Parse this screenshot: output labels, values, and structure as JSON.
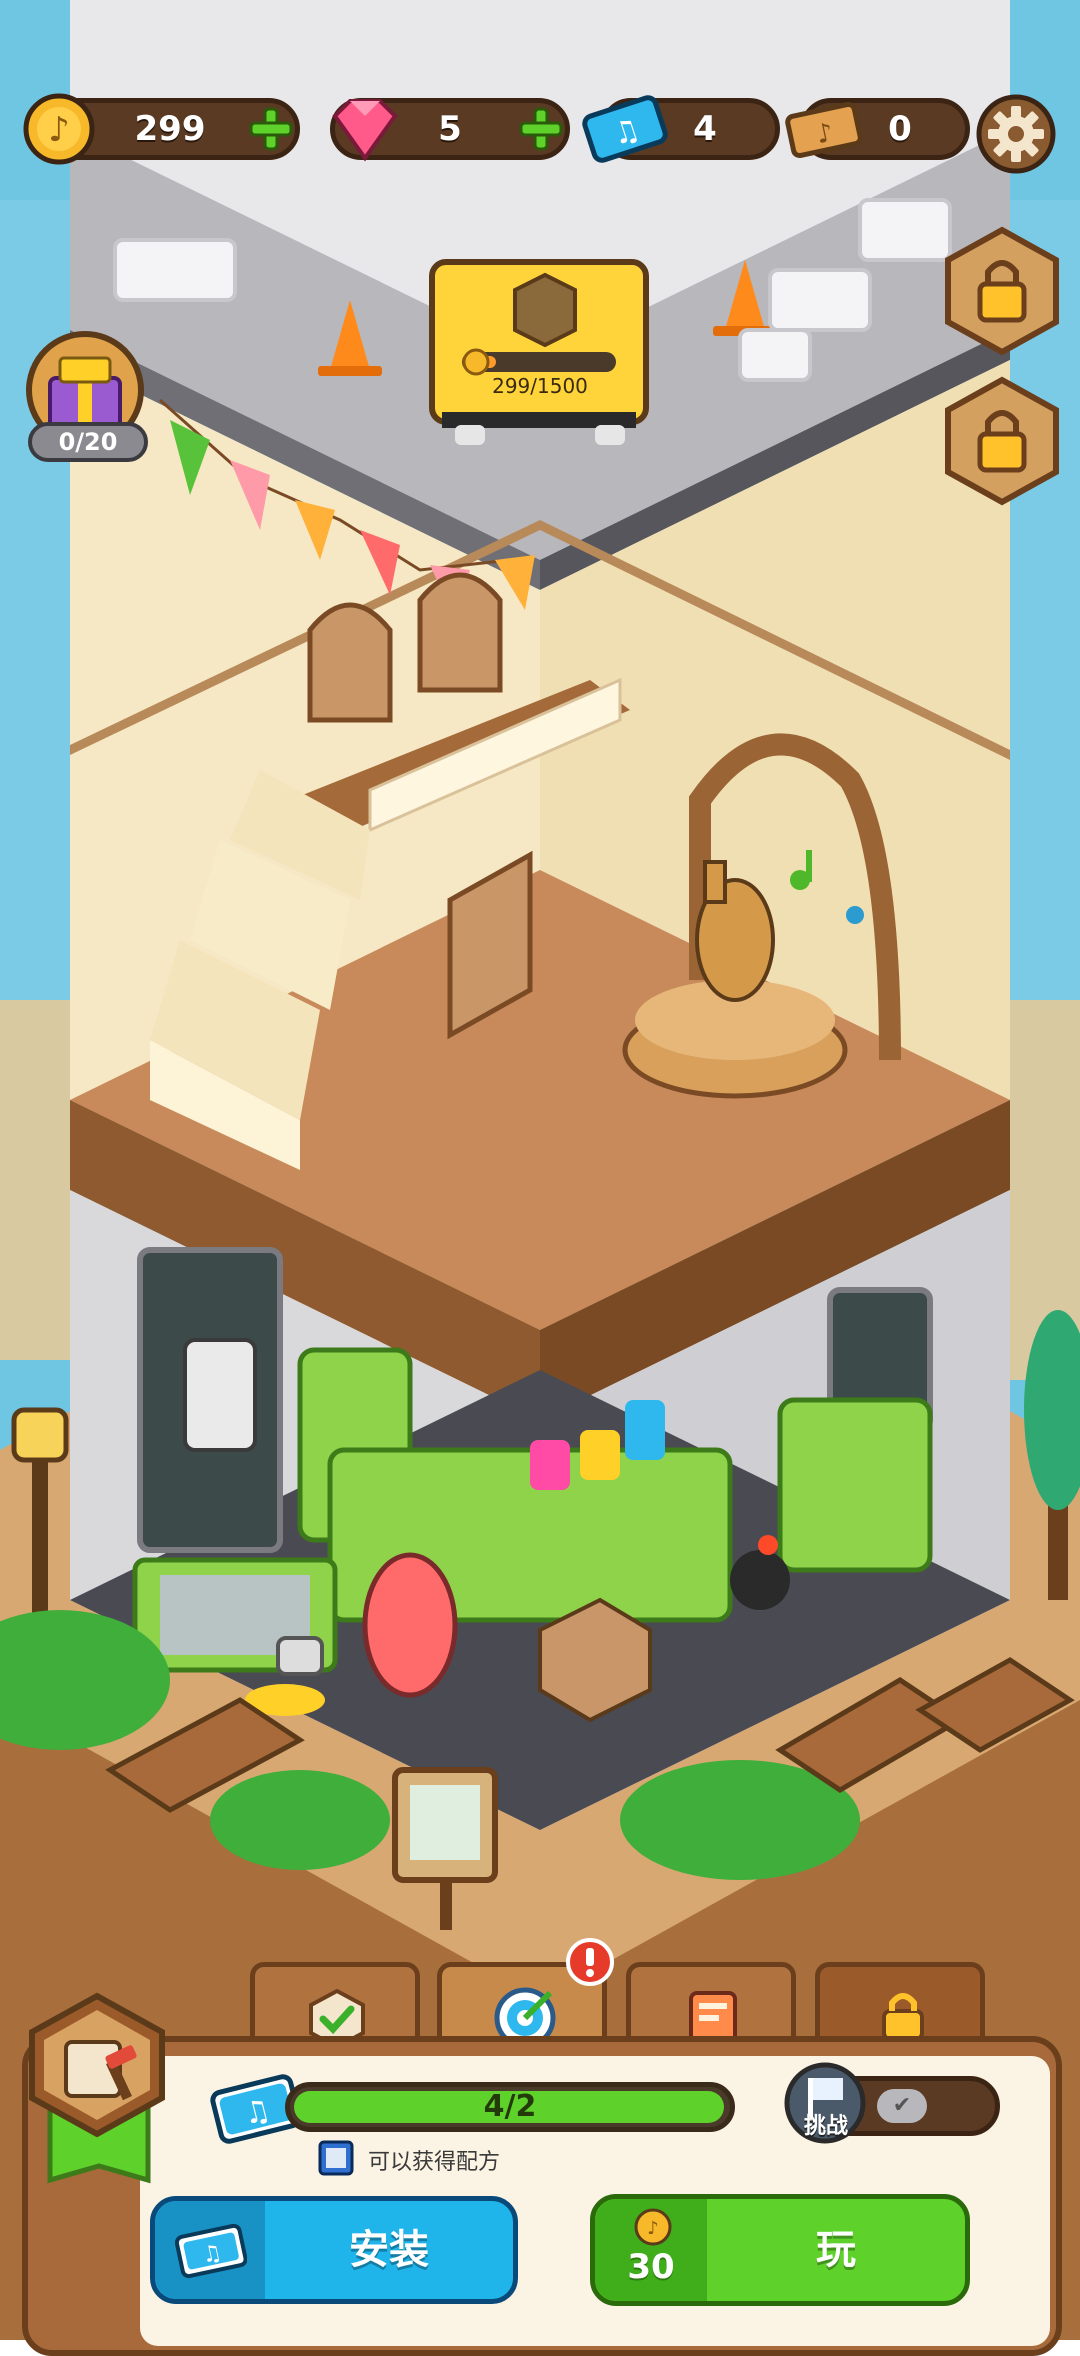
{
  "hud": {
    "coins": "299",
    "gems": "5",
    "music_tickets": "4",
    "gold_tickets": "0"
  },
  "construction": {
    "progress_text": "299/1500",
    "progress_fraction": 0.199
  },
  "gift_counter": "0/20",
  "panel": {
    "progress_text": "4/2",
    "progress_fraction": 1.0,
    "challenge_label": "挑战",
    "hint_text": "可以获得配方",
    "install_label": "安装",
    "play_label": "玩",
    "play_cost": "30"
  },
  "tabs": [
    "checklist",
    "target",
    "book",
    "locked"
  ],
  "colors": {
    "coin": "#f7b92a",
    "gem": "#ff5a8a",
    "green": "#5fd12b",
    "blue": "#1fb4ea",
    "brown": "#6b3f1c"
  }
}
